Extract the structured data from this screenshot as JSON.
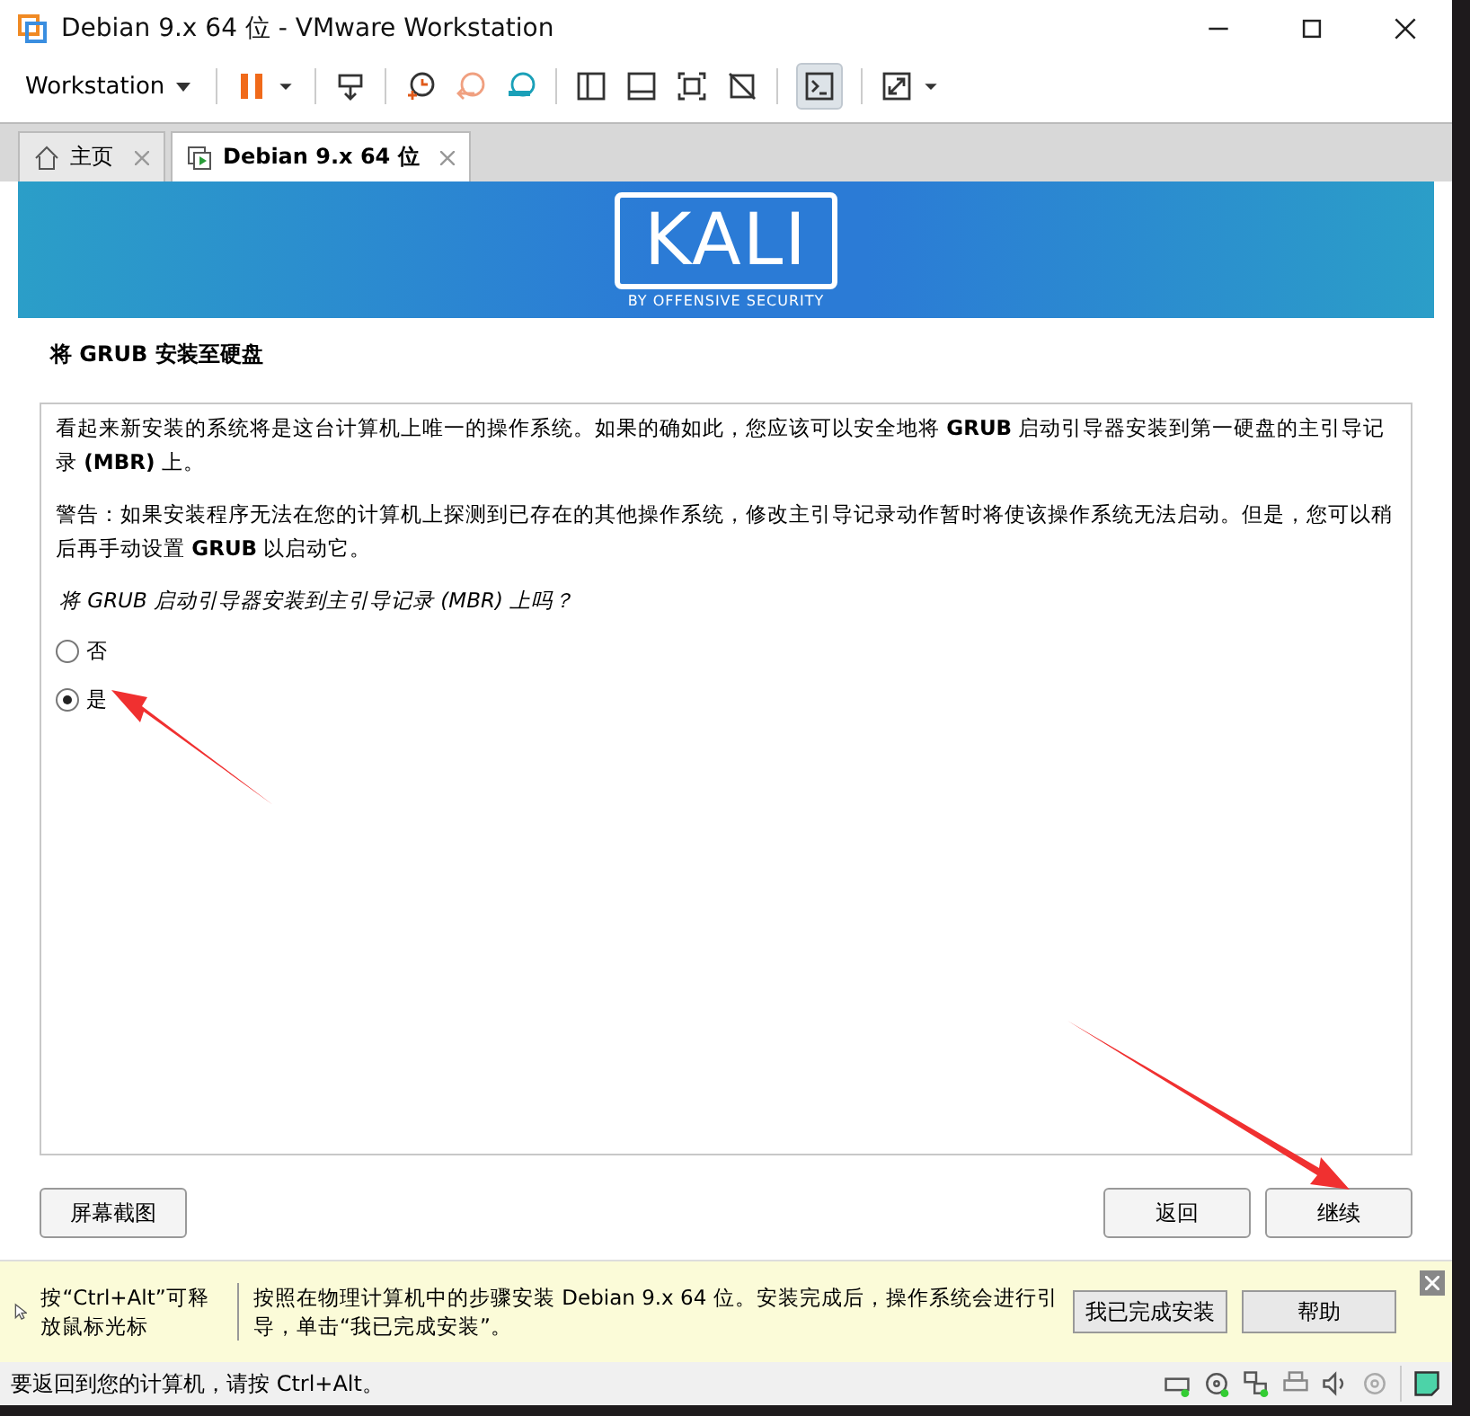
{
  "window": {
    "title": "Debian 9.x 64 位 - VMware Workstation"
  },
  "toolbar": {
    "menu": "Workstation"
  },
  "tabs": [
    {
      "label": "主页",
      "kind": "home",
      "selected": false
    },
    {
      "label": "Debian 9.x 64 位",
      "kind": "vm",
      "selected": true
    }
  ],
  "banner": {
    "logo": "KALI",
    "tagline": "BY OFFENSIVE SECURITY"
  },
  "installer": {
    "title": "将 GRUB 安装至硬盘",
    "paragraphs": [
      "看起来新安装的系统将是这台计算机上唯一的操作系统。如果的确如此，您应该可以安全地将 **GRUB** 启动引导器安装到第一硬盘的主引导记录 **(MBR)** 上。",
      "警告：如果安装程序无法在您的计算机上探测到已存在的其他操作系统，修改主引导记录动作暂时将使该操作系统无法启动。但是，您可以稍后再手动设置 **GRUB** 以启动它。"
    ],
    "question": "将 GRUB 启动引导器安装到主引导记录 (MBR) 上吗？",
    "options": [
      {
        "label": "否",
        "selected": false
      },
      {
        "label": "是",
        "selected": true
      }
    ],
    "screenshot_button": "屏幕截图",
    "back_button": "返回",
    "continue_button": "继续"
  },
  "hint_bar": {
    "mouse_hint": "按“Ctrl+Alt”可释放鼠标光标",
    "message": "按照在物理计算机中的步骤安装 Debian 9.x 64 位。安装完成后，操作系统会进行引导，单击“我已完成安装”。",
    "done_button": "我已完成安装",
    "help_button": "帮助"
  },
  "status_bar": {
    "text": "要返回到您的计算机，请按 Ctrl+Alt。"
  }
}
